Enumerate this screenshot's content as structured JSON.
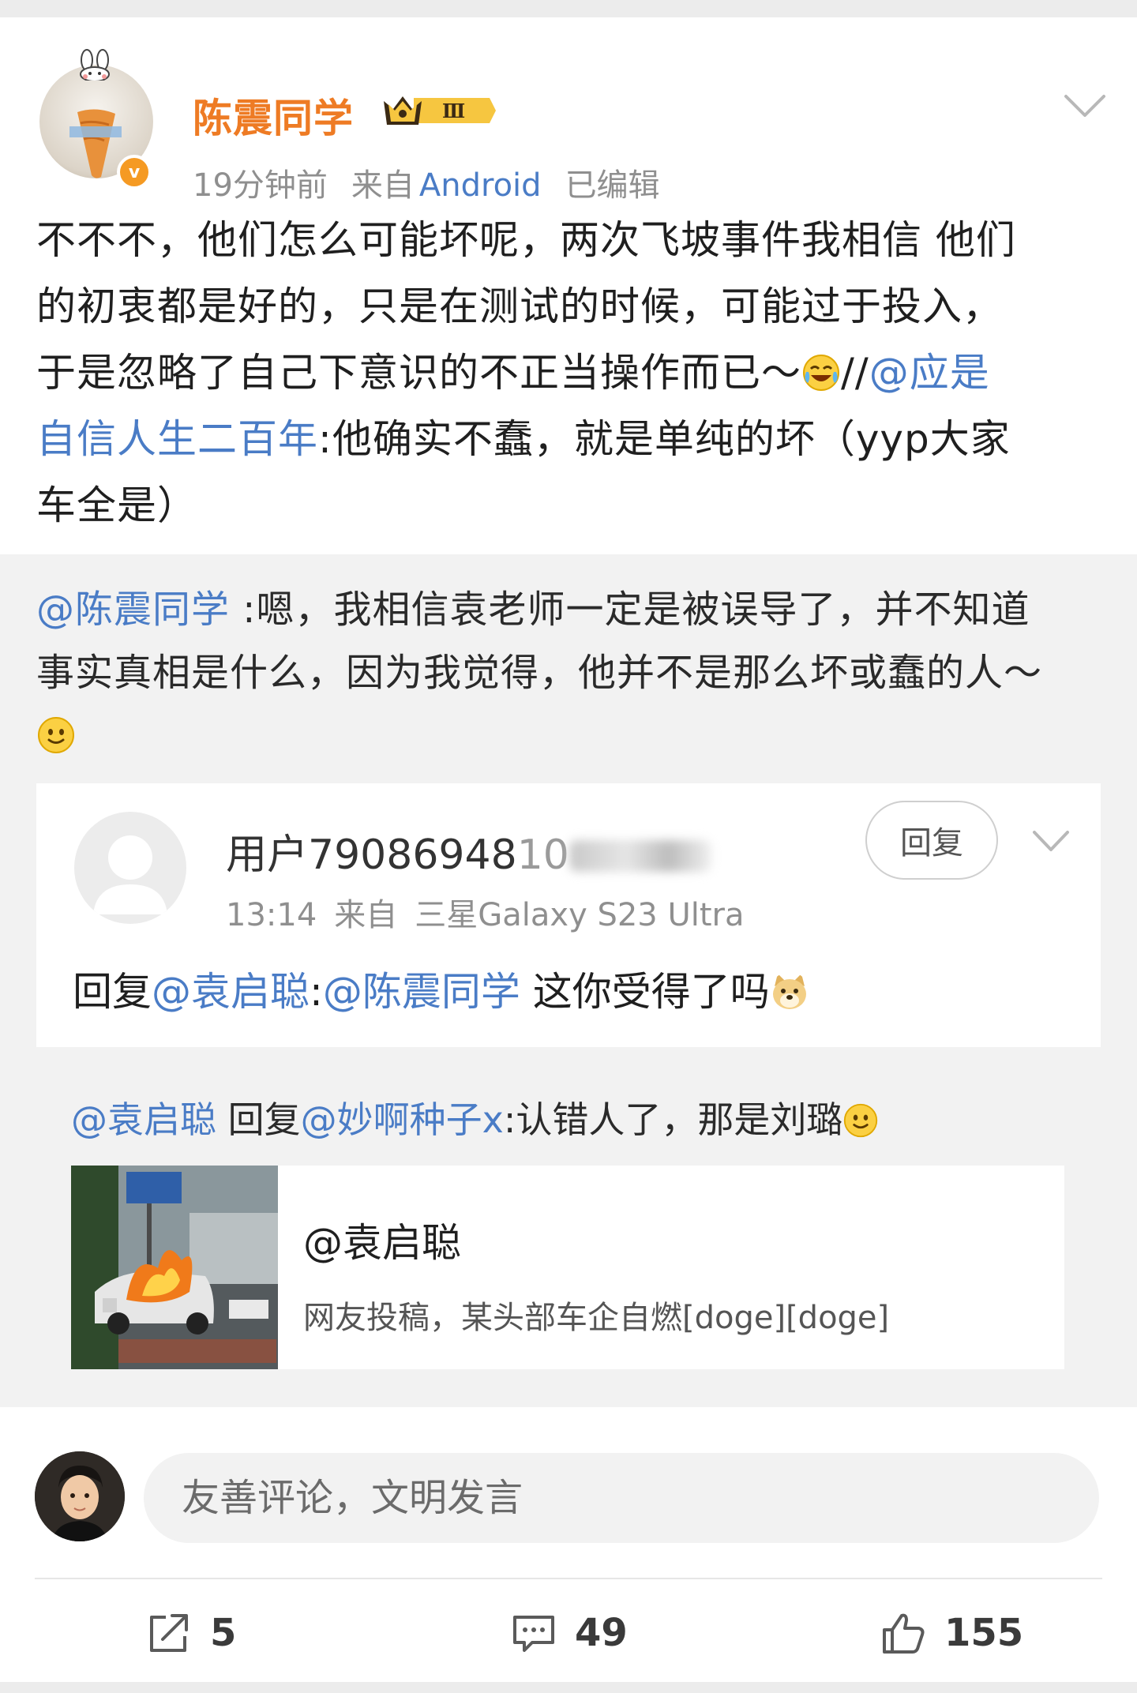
{
  "header": {
    "username": "陈震同学",
    "vip_level": "Ⅲ",
    "time": "19分钟前",
    "source_prefix": "来自",
    "source": "Android",
    "edited": "已编辑"
  },
  "post": {
    "line1": "不不不，他们怎么可能坏呢，两次飞坡事件我相信 他们",
    "line2": "的初衷都是好的，只是在测试的时候，可能过于投入，",
    "line3_text": "于是忽略了自己下意识的不正当操作而已～",
    "line3_slashes": "//",
    "mention_part1": "@应是",
    "mention_part2": "自信人生二百年",
    "line4_rest": ":他确实不蠢，就是单纯的坏（yyp大家",
    "line5": "车全是）"
  },
  "repost": {
    "mention": "@陈震同学",
    "line1_rest": " :嗯，我相信袁老师一定是被误导了，并不知道",
    "line2": "事实真相是什么，因为我觉得，他并不是那么坏或蠢的人～"
  },
  "comment": {
    "username": "用户79086948",
    "username_tail": "10",
    "time": "13:14",
    "source_prefix": "来自",
    "source": "三星Galaxy S23 Ultra",
    "reply_button": "回复",
    "body_prefix": "回复",
    "mention1": "@袁启聪",
    "colon": ":",
    "mention2": "@陈震同学",
    "body_rest": " 这你受得了吗"
  },
  "reply_line": {
    "mention1": "@袁启聪",
    "mid": " 回复",
    "mention2": "@妙啊种子x",
    "rest": ":认错人了，那是刘璐"
  },
  "shared_card": {
    "title": "@袁启聪",
    "description": "网友投稿，某头部车企自燃[doge][doge]"
  },
  "input": {
    "placeholder": "友善评论，文明发言"
  },
  "actions": {
    "repost_count": "5",
    "comment_count": "49",
    "like_count": "155"
  }
}
